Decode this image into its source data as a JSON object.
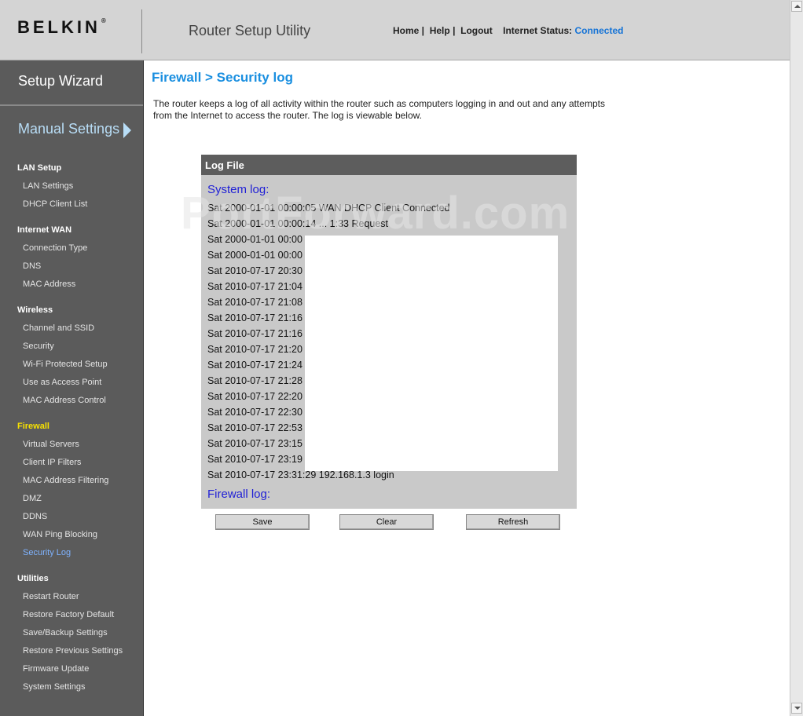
{
  "header": {
    "logo": "BELKIN",
    "logo_mark": "®",
    "utility_title": "Router Setup Utility",
    "links": [
      "Home",
      "Help",
      "Logout"
    ],
    "status_label": "Internet Status:",
    "status_value": "Connected",
    "status_color": "#1573d6"
  },
  "sidebar": {
    "wizard": "Setup Wizard",
    "manual": "Manual Settings",
    "sections": [
      {
        "title": "LAN Setup",
        "items": [
          "LAN Settings",
          "DHCP Client List"
        ]
      },
      {
        "title": "Internet WAN",
        "items": [
          "Connection Type",
          "DNS",
          "MAC Address"
        ]
      },
      {
        "title": "Wireless",
        "items": [
          "Channel and SSID",
          "Security",
          "Wi-Fi Protected Setup",
          "Use as Access Point",
          "MAC Address Control"
        ]
      },
      {
        "title": "Firewall",
        "items": [
          "Virtual Servers",
          "Client IP Filters",
          "MAC Address Filtering",
          "DMZ",
          "DDNS",
          "WAN Ping Blocking",
          "Security Log"
        ]
      },
      {
        "title": "Utilities",
        "items": [
          "Restart Router",
          "Restore Factory Default",
          "Save/Backup Settings",
          "Restore Previous Settings",
          "Firmware Update",
          "System Settings"
        ]
      }
    ],
    "active_section": "Firewall",
    "current_item": "Security Log",
    "active_color": "#f7e100",
    "current_color": "#7fb3ff"
  },
  "main": {
    "title": "Firewall > Security log",
    "intro": "The router keeps a log of all activity within the router such as computers logging in and out and any attempts from the Internet to access the router. The log is viewable below.",
    "log_panel": {
      "header": "Log File",
      "system_log_label": "System log:",
      "lines": [
        "Sat 2000-01-01 00:00:05 WAN DHCP Client Connected",
        "Sat 2000-01-01 00:00:14 ... 1:33 Request",
        "Sat 2000-01-01 00:00",
        "Sat 2000-01-01 00:00",
        "Sat 2010-07-17 20:30",
        "Sat 2010-07-17 21:04",
        "Sat 2010-07-17 21:08",
        "Sat 2010-07-17 21:16",
        "Sat 2010-07-17 21:16",
        "Sat 2010-07-17 21:20",
        "Sat 2010-07-17 21:24",
        "Sat 2010-07-17 21:28",
        "Sat 2010-07-17 22:20",
        "Sat 2010-07-17 22:30",
        "Sat 2010-07-17 22:53",
        "Sat 2010-07-17 23:15",
        "Sat 2010-07-17 23:19",
        "Sat 2010-07-17 23:31:29 192.168.1.3 login"
      ],
      "firewall_log_label": "Firewall log:"
    },
    "buttons": {
      "save": "Save",
      "clear": "Clear",
      "refresh": "Refresh"
    },
    "watermark": "PortForward.com"
  }
}
